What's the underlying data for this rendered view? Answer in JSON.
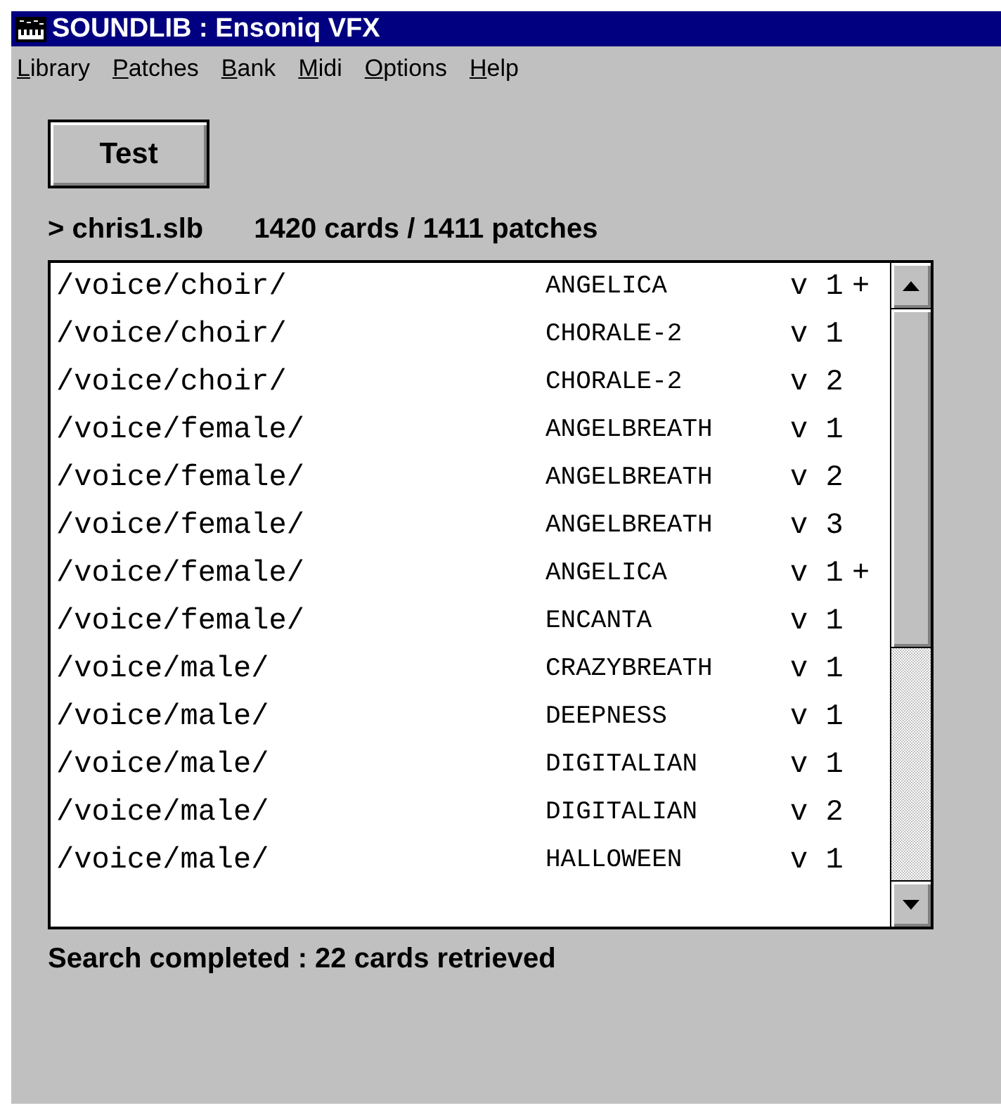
{
  "window": {
    "title": "SOUNDLIB : Ensoniq VFX"
  },
  "menu": [
    {
      "label": "Library"
    },
    {
      "label": "Patches"
    },
    {
      "label": "Bank"
    },
    {
      "label": "Midi"
    },
    {
      "label": "Options"
    },
    {
      "label": "Help"
    }
  ],
  "test_button": "Test",
  "library_file": "> chris1.slb",
  "library_counts": "1420 cards / 1411 patches",
  "rows": [
    {
      "path": "/voice/choir/",
      "name": "ANGELICA",
      "version": "v 1",
      "mark": "+"
    },
    {
      "path": "/voice/choir/",
      "name": "CHORALE-2",
      "version": "v 1"
    },
    {
      "path": "/voice/choir/",
      "name": "CHORALE-2",
      "version": "v 2"
    },
    {
      "path": "/voice/female/",
      "name": "ANGELBREATH",
      "version": "v 1"
    },
    {
      "path": "/voice/female/",
      "name": "ANGELBREATH",
      "version": "v 2"
    },
    {
      "path": "/voice/female/",
      "name": "ANGELBREATH",
      "version": "v 3"
    },
    {
      "path": "/voice/female/",
      "name": "ANGELICA",
      "version": "v 1",
      "mark": "+"
    },
    {
      "path": "/voice/female/",
      "name": "ENCANTA",
      "version": "v 1"
    },
    {
      "path": "/voice/male/",
      "name": "CRAZYBREATH",
      "version": "v 1"
    },
    {
      "path": "/voice/male/",
      "name": "DEEPNESS",
      "version": "v 1"
    },
    {
      "path": "/voice/male/",
      "name": "DIGITALIAN",
      "version": "v 1"
    },
    {
      "path": "/voice/male/",
      "name": "DIGITALIAN",
      "version": "v 2"
    },
    {
      "path": "/voice/male/",
      "name": "HALLOWEEN",
      "version": "v 1"
    }
  ],
  "status": "Search completed : 22 cards retrieved"
}
